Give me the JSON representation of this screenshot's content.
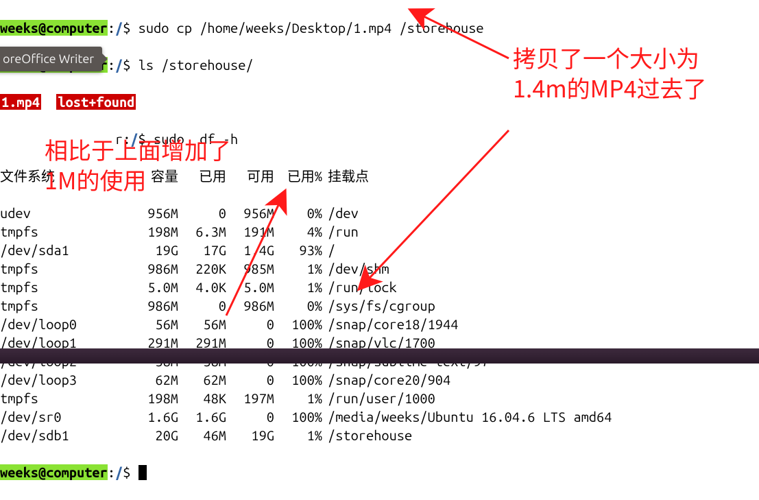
{
  "prompt": {
    "user_host": "weeks@computer",
    "path": "/",
    "symbol": "$"
  },
  "lines": {
    "cmd1": "sudo cp /home/weeks/Desktop/1.mp4 /storehouse",
    "cmd2": "ls /storehouse/",
    "ls_output_a": "1.mp4",
    "ls_output_b": "lost+found",
    "cmd_cut_prefix": "r",
    "cmd3": "sudo  df -h"
  },
  "df": {
    "headers": {
      "fs": "文件系统",
      "size": "容量",
      "used": "已用",
      "avail": "可用",
      "usep": "已用%",
      "mount": "挂载点"
    },
    "rows": [
      {
        "fs": "udev",
        "size": "956M",
        "used": "0",
        "avail": "956M",
        "usep": "0%",
        "mount": "/dev"
      },
      {
        "fs": "tmpfs",
        "size": "198M",
        "used": "6.3M",
        "avail": "191M",
        "usep": "4%",
        "mount": "/run"
      },
      {
        "fs": "/dev/sda1",
        "size": "19G",
        "used": "17G",
        "avail": "1.4G",
        "usep": "93%",
        "mount": "/"
      },
      {
        "fs": "tmpfs",
        "size": "986M",
        "used": "220K",
        "avail": "985M",
        "usep": "1%",
        "mount": "/dev/shm"
      },
      {
        "fs": "tmpfs",
        "size": "5.0M",
        "used": "4.0K",
        "avail": "5.0M",
        "usep": "1%",
        "mount": "/run/lock"
      },
      {
        "fs": "tmpfs",
        "size": "986M",
        "used": "0",
        "avail": "986M",
        "usep": "0%",
        "mount": "/sys/fs/cgroup"
      },
      {
        "fs": "/dev/loop0",
        "size": "56M",
        "used": "56M",
        "avail": "0",
        "usep": "100%",
        "mount": "/snap/core18/1944"
      },
      {
        "fs": "/dev/loop1",
        "size": "291M",
        "used": "291M",
        "avail": "0",
        "usep": "100%",
        "mount": "/snap/vlc/1700"
      },
      {
        "fs": "/dev/loop2",
        "size": "58M",
        "used": "58M",
        "avail": "0",
        "usep": "100%",
        "mount": "/snap/sublime-text/97"
      },
      {
        "fs": "/dev/loop3",
        "size": "62M",
        "used": "62M",
        "avail": "0",
        "usep": "100%",
        "mount": "/snap/core20/904"
      },
      {
        "fs": "tmpfs",
        "size": "198M",
        "used": "48K",
        "avail": "197M",
        "usep": "1%",
        "mount": "/run/user/1000"
      },
      {
        "fs": "/dev/sr0",
        "size": "1.6G",
        "used": "1.6G",
        "avail": "0",
        "usep": "100%",
        "mount": "/media/weeks/Ubuntu 16.04.6 LTS amd64"
      },
      {
        "fs": "/dev/sdb1",
        "size": "20G",
        "used": "46M",
        "avail": "19G",
        "usep": "1%",
        "mount": "/storehouse"
      }
    ]
  },
  "annotations": {
    "right": "拷贝了一个大小为1.4m的MP4过去了",
    "left": "相比于上面增加了1M的使用"
  },
  "badge": {
    "label": "oreOffice Writer"
  }
}
